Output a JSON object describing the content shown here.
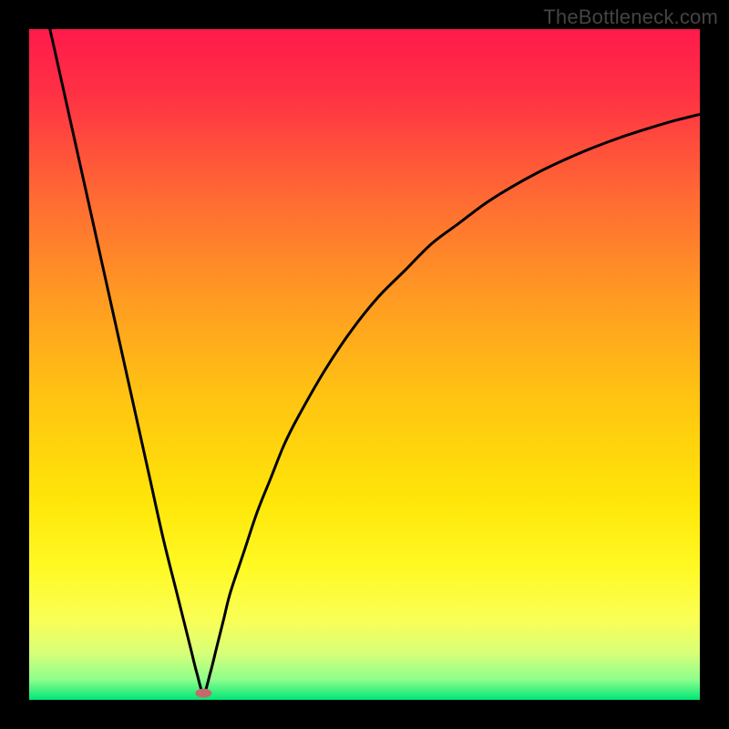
{
  "watermark": "TheBottleneck.com",
  "chart_data": {
    "type": "line",
    "title": "",
    "xlabel": "",
    "ylabel": "",
    "xlim": [
      0,
      100
    ],
    "ylim": [
      0,
      100
    ],
    "grid": false,
    "background_gradient": {
      "stops": [
        {
          "offset": 0.0,
          "color": "#ff1a4b"
        },
        {
          "offset": 0.1,
          "color": "#ff3244"
        },
        {
          "offset": 0.25,
          "color": "#ff6a33"
        },
        {
          "offset": 0.4,
          "color": "#ff9a22"
        },
        {
          "offset": 0.55,
          "color": "#ffc412"
        },
        {
          "offset": 0.7,
          "color": "#ffe508"
        },
        {
          "offset": 0.8,
          "color": "#fff923"
        },
        {
          "offset": 0.88,
          "color": "#faff55"
        },
        {
          "offset": 0.93,
          "color": "#d8ff78"
        },
        {
          "offset": 0.97,
          "color": "#8cff8c"
        },
        {
          "offset": 1.0,
          "color": "#00e676"
        }
      ]
    },
    "curve_minimum_x": 26,
    "series": [
      {
        "name": "left-branch",
        "x": [
          0,
          2,
          4,
          6,
          8,
          10,
          12,
          14,
          16,
          18,
          20,
          22,
          24,
          25,
          26
        ],
        "y": [
          115,
          105,
          96,
          87,
          78,
          69,
          60,
          51,
          42,
          33,
          24,
          16,
          8,
          4,
          1
        ]
      },
      {
        "name": "right-branch",
        "x": [
          26,
          27,
          28,
          29,
          30,
          32,
          34,
          36,
          38,
          40,
          44,
          48,
          52,
          56,
          60,
          64,
          68,
          72,
          76,
          80,
          84,
          88,
          92,
          96,
          100
        ],
        "y": [
          1,
          4,
          8,
          12,
          16,
          22,
          28,
          33,
          38,
          42,
          49,
          55,
          60,
          64,
          68,
          71,
          74,
          76.5,
          78.7,
          80.6,
          82.3,
          83.8,
          85.1,
          86.3,
          87.3
        ]
      }
    ],
    "marker": {
      "x": 26,
      "y": 1,
      "color": "#c46a6a",
      "rx": 9,
      "ry": 5
    }
  }
}
